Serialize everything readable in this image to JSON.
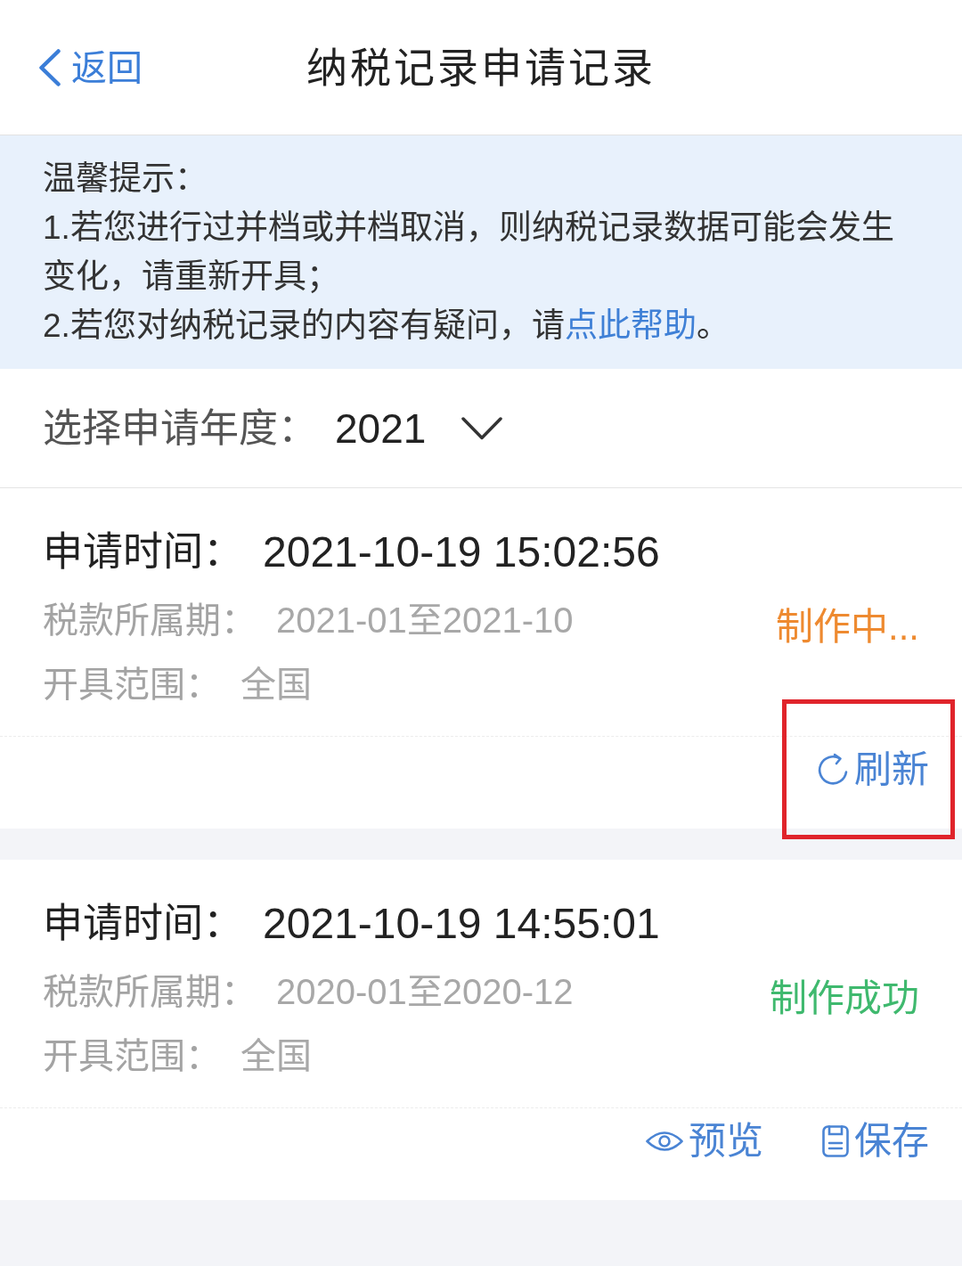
{
  "header": {
    "back_label": "返回",
    "title": "纳税记录申请记录"
  },
  "notice": {
    "heading": "温馨提示：",
    "items": [
      {
        "text": "1.若您进行过并档或并档取消，则纳税记录数据可能会发生变化，请重新开具；"
      },
      {
        "text": "2.若您对纳税记录的内容有疑问，请",
        "link": "点此帮助",
        "text_after": "。"
      }
    ]
  },
  "year_filter": {
    "label": "选择申请年度：",
    "value": "2021"
  },
  "records": [
    {
      "time_label": "申请时间：",
      "time": "2021-10-19 15:02:56",
      "period_label": "税款所属期：",
      "period": "2021-01至2021-10",
      "scope_label": "开具范围：",
      "scope": "全国",
      "status": {
        "text": "制作中...",
        "color": "#ee8a30"
      },
      "actions": [
        {
          "kind": "refresh",
          "label": "刷新",
          "highlighted": true
        }
      ]
    },
    {
      "time_label": "申请时间：",
      "time": "2021-10-19 14:55:01",
      "period_label": "税款所属期：",
      "period": "2020-01至2020-12",
      "scope_label": "开具范围：",
      "scope": "全国",
      "status": {
        "text": "制作成功",
        "color": "#3fb96e"
      },
      "actions": [
        {
          "kind": "preview",
          "label": "预览",
          "highlighted": false
        },
        {
          "kind": "save",
          "label": "保存",
          "highlighted": false
        }
      ]
    }
  ]
}
